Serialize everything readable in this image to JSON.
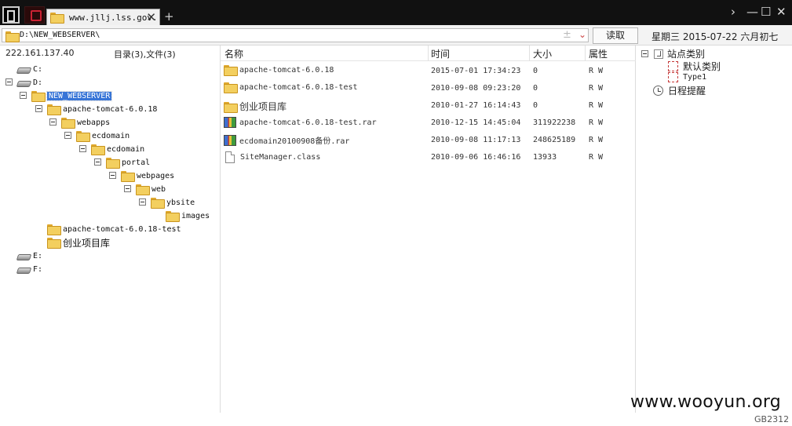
{
  "titlebar": {
    "tab_title": "www.jllj.lss.gov.cn",
    "tab_close": "✕",
    "new_tab": "+",
    "window_controls": [
      "›",
      "—",
      "☐",
      "✕"
    ]
  },
  "addressbar": {
    "path": "D:\\NEW_WEBSERVER\\",
    "plus_icon": "±",
    "dropdown_icon": "⌄",
    "read_button": "读取",
    "date_text": "星期三  2015-07-22  六月初七"
  },
  "left": {
    "ip": "222.161.137.40",
    "counts": "目录(3),文件(3)",
    "tree": [
      {
        "label": "C:",
        "type": "drive"
      },
      {
        "label": "D:",
        "type": "drive"
      },
      {
        "label": "NEW_WEBSERVER",
        "type": "folder",
        "selected": true
      },
      {
        "label": "apache-tomcat-6.0.18",
        "type": "folder"
      },
      {
        "label": "webapps",
        "type": "folder"
      },
      {
        "label": "ecdomain",
        "type": "folder"
      },
      {
        "label": "ecdomain",
        "type": "folder"
      },
      {
        "label": "portal",
        "type": "folder"
      },
      {
        "label": "webpages",
        "type": "folder"
      },
      {
        "label": "web",
        "type": "folder"
      },
      {
        "label": "ybsite",
        "type": "folder"
      },
      {
        "label": "images",
        "type": "folder"
      },
      {
        "label": "apache-tomcat-6.0.18-test",
        "type": "folder"
      },
      {
        "label": "创业项目库",
        "type": "folder"
      },
      {
        "label": "E:",
        "type": "drive"
      },
      {
        "label": "F:",
        "type": "drive"
      }
    ]
  },
  "filelist": {
    "columns": [
      "名称",
      "时间",
      "大小",
      "属性"
    ],
    "rows": [
      {
        "name": "apache-tomcat-6.0.18",
        "time": "2015-07-01 17:34:23",
        "size": "0",
        "attr": "R W",
        "icon": "folder"
      },
      {
        "name": "apache-tomcat-6.0.18-test",
        "time": "2010-09-08 09:23:20",
        "size": "0",
        "attr": "R W",
        "icon": "folder"
      },
      {
        "name": "创业项目库",
        "time": "2010-01-27 16:14:43",
        "size": "0",
        "attr": "R W",
        "icon": "folder"
      },
      {
        "name": "apache-tomcat-6.0.18-test.rar",
        "time": "2010-12-15 14:45:04",
        "size": "311922238",
        "attr": "R W",
        "icon": "rar"
      },
      {
        "name": "ecdomain20100908备份.rar",
        "time": "2010-09-08 11:17:13",
        "size": "248625189",
        "attr": "R W",
        "icon": "rar"
      },
      {
        "name": "SiteManager.class",
        "time": "2010-09-06 16:46:16",
        "size": "13933",
        "attr": "R W",
        "icon": "file"
      }
    ]
  },
  "right": {
    "site_category": "站点类别",
    "default_category": "默认类别",
    "type1": "Type1",
    "schedule": "日程提醒"
  },
  "footer": {
    "watermark": "www.wooyun.org",
    "encoding": "GB2312"
  },
  "colors": {
    "titlebar_bg": "#111111",
    "selection": "#3875d7",
    "folder": "#f3cf5f"
  }
}
